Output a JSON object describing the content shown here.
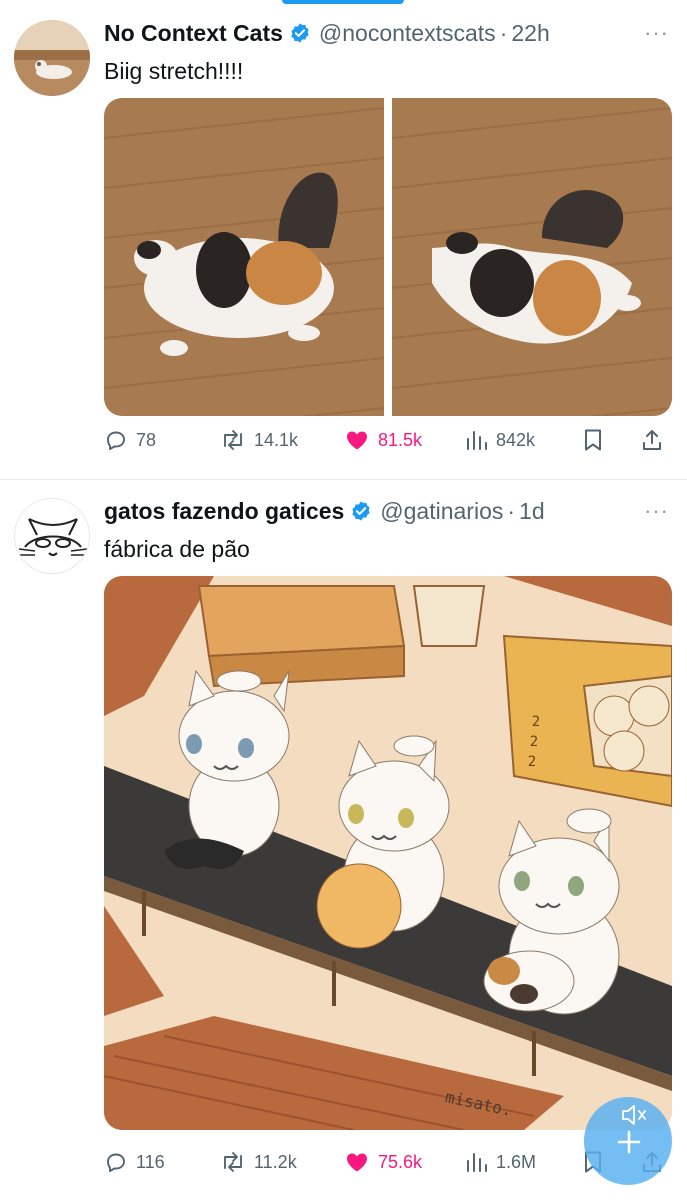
{
  "tweets": [
    {
      "name": "No Context Cats",
      "handle": "@nocontextscats",
      "separator": "·",
      "time": "22h",
      "more": "···",
      "text": "Biig stretch!!!!",
      "replies": "78",
      "retweets": "14.1k",
      "likes": "81.5k",
      "views": "842k"
    },
    {
      "name": "gatos fazendo gatices",
      "handle": "@gatinarios",
      "separator": "·",
      "time": "1d",
      "more": "···",
      "text": "fábrica de pão",
      "image_signature": "misato.",
      "box_numbers": [
        "2",
        "2",
        "2"
      ],
      "replies": "116",
      "retweets": "11.2k",
      "likes": "75.6k",
      "views": "1.6M"
    }
  ],
  "colors": {
    "accent": "#1d9bf0",
    "like": "#f91880",
    "muted": "#536471"
  },
  "icons": [
    "reply-icon",
    "retweet-icon",
    "like-icon",
    "views-icon",
    "bookmark-icon",
    "share-icon",
    "verified-icon",
    "more-icon",
    "compose-icon",
    "mute-icon"
  ]
}
